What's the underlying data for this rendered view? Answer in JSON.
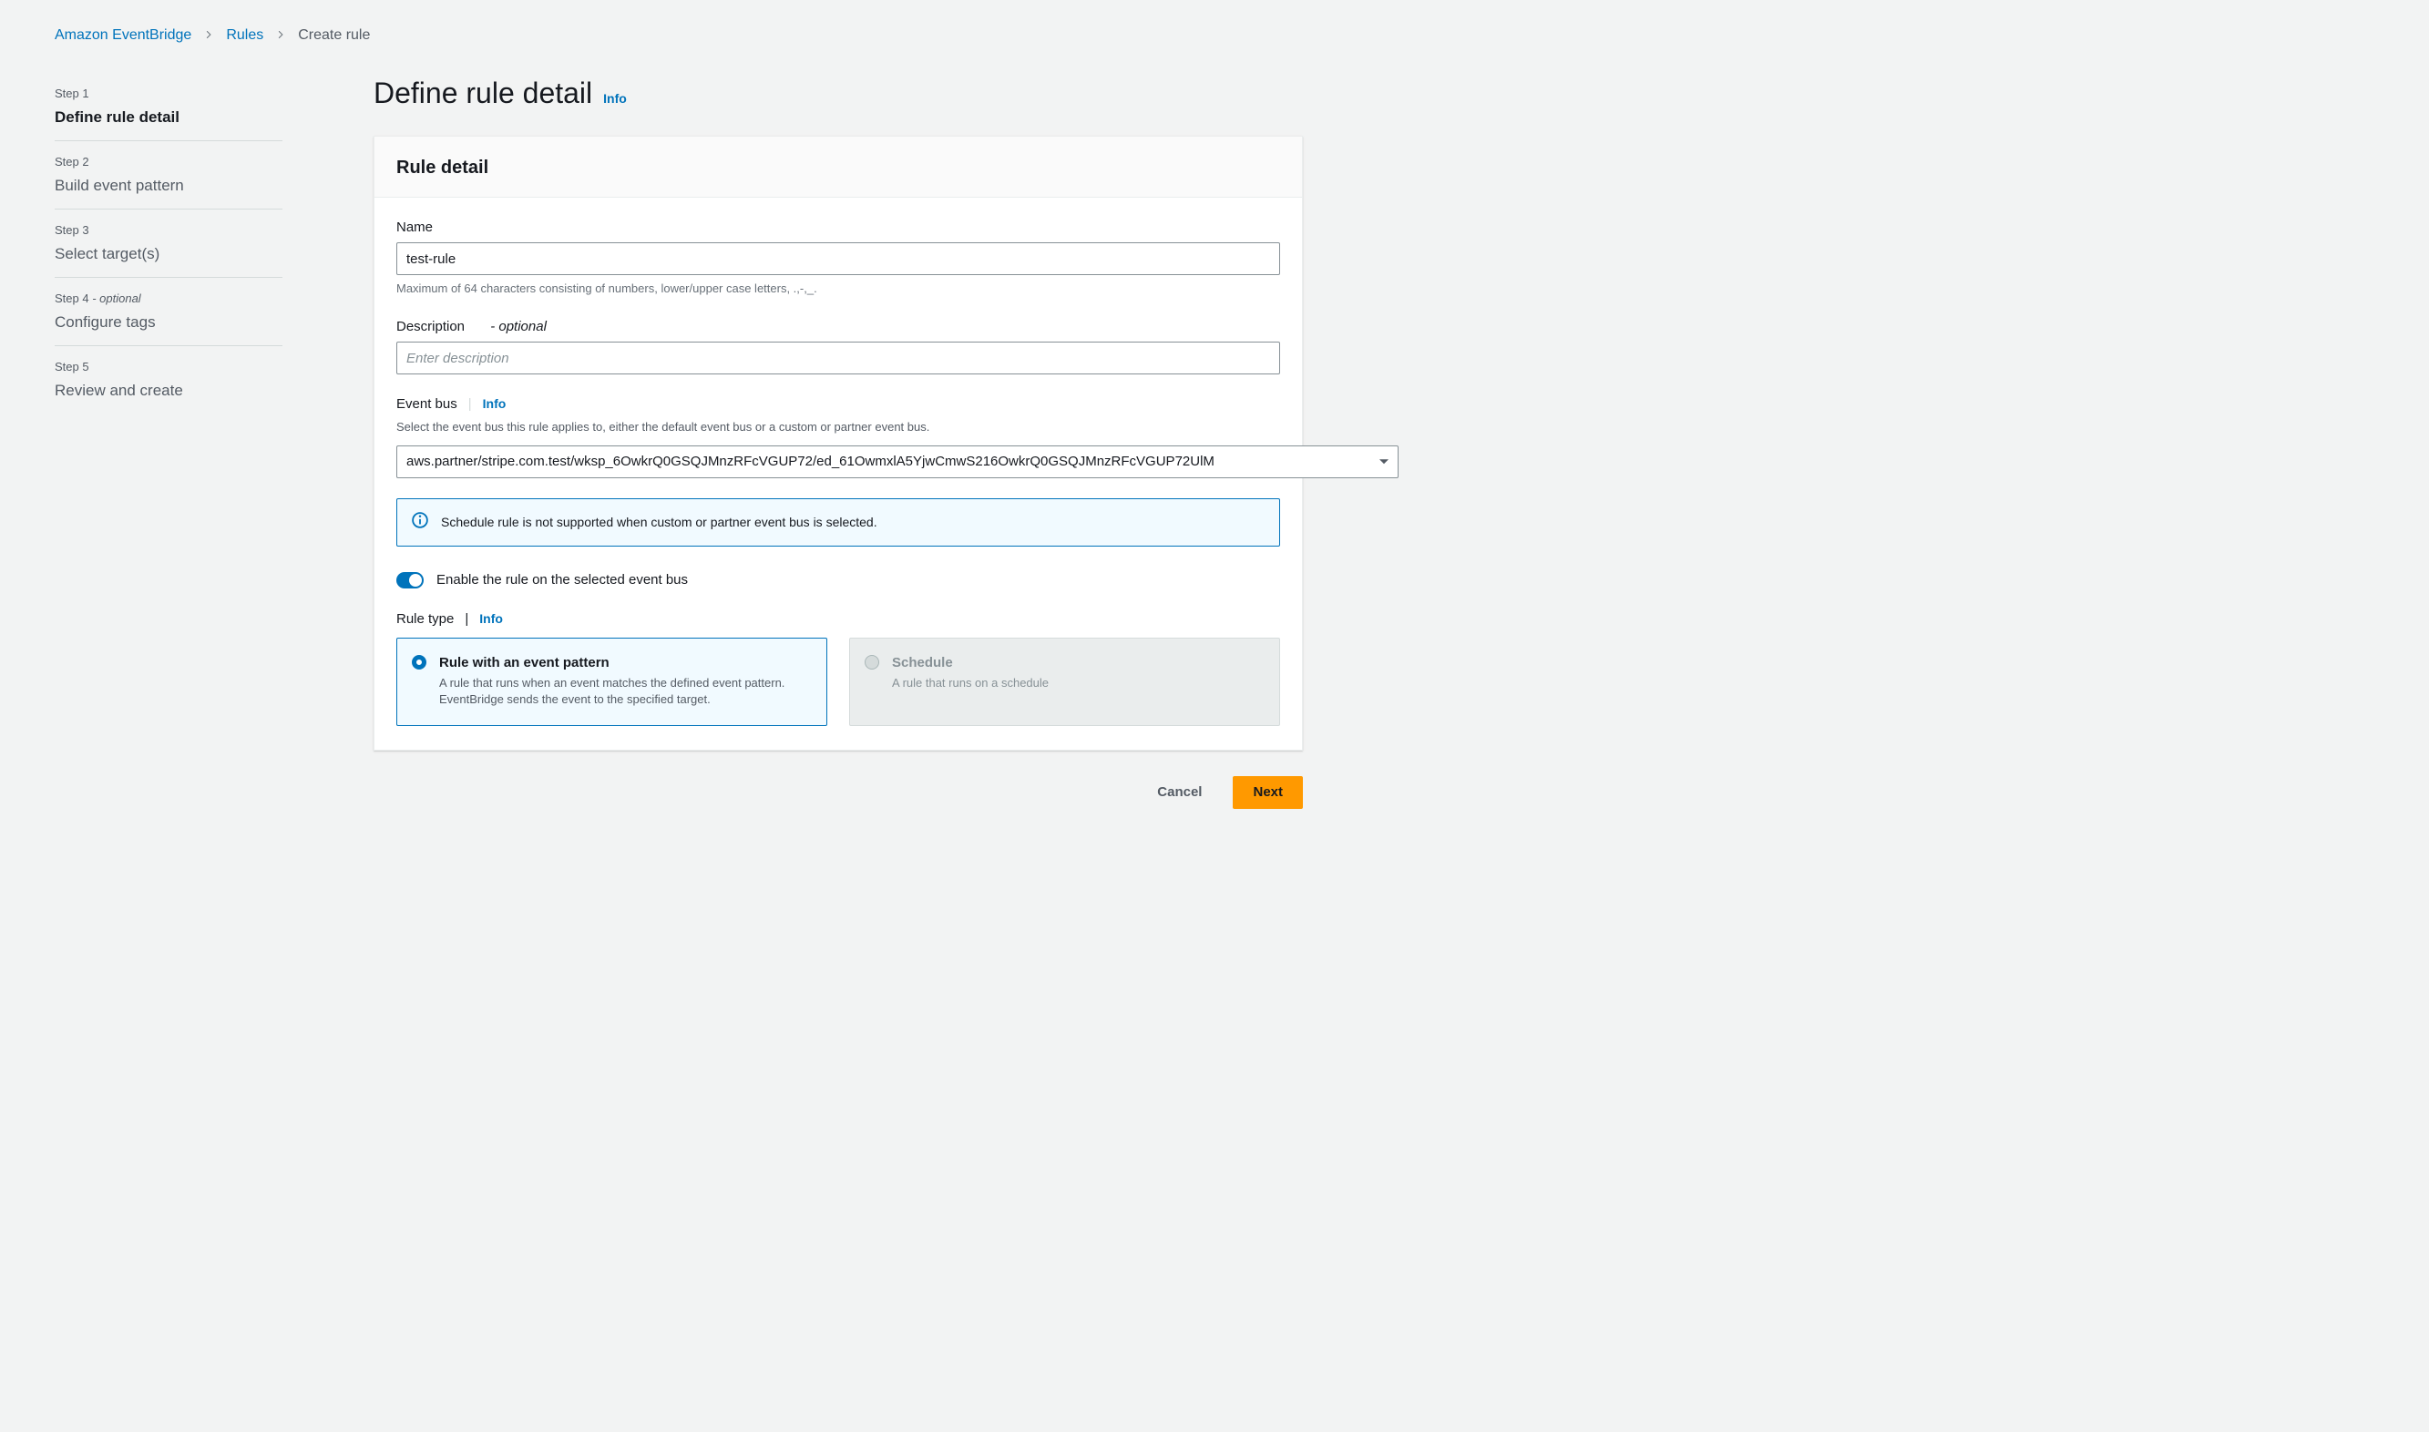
{
  "breadcrumb": {
    "service": "Amazon EventBridge",
    "section": "Rules",
    "current": "Create rule"
  },
  "steps": [
    {
      "num": "Step 1",
      "title": "Define rule detail",
      "optional": false,
      "active": true
    },
    {
      "num": "Step 2",
      "title": "Build event pattern",
      "optional": false,
      "active": false
    },
    {
      "num": "Step 3",
      "title": "Select target(s)",
      "optional": false,
      "active": false
    },
    {
      "num": "Step 4",
      "title": "Configure tags",
      "optional": true,
      "active": false
    },
    {
      "num": "Step 5",
      "title": "Review and create",
      "optional": false,
      "active": false
    }
  ],
  "page": {
    "title": "Define rule detail",
    "info": "Info"
  },
  "panel": {
    "header": "Rule detail",
    "name": {
      "label": "Name",
      "value": "test-rule",
      "help": "Maximum of 64 characters consisting of numbers, lower/upper case letters, .,-,_."
    },
    "description": {
      "label": "Description",
      "optional_suffix": "- optional",
      "placeholder": "Enter description",
      "value": ""
    },
    "event_bus": {
      "label": "Event bus",
      "info": "Info",
      "desc": "Select the event bus this rule applies to, either the default event bus or a custom or partner event bus.",
      "value": "aws.partner/stripe.com.test/wksp_6OwkrQ0GSQJMnzRFcVGUP72/ed_61OwmxlA5YjwCmwS216OwkrQ0GSQJMnzRFcVGUP72UlM"
    },
    "alert": "Schedule rule is not supported when custom or partner event bus is selected.",
    "enable_toggle": {
      "label": "Enable the rule on the selected event bus",
      "on": true
    },
    "rule_type": {
      "label": "Rule type",
      "info": "Info",
      "options": [
        {
          "title": "Rule with an event pattern",
          "desc": "A rule that runs when an event matches the defined event pattern. EventBridge sends the event to the specified target.",
          "selected": true,
          "disabled": false
        },
        {
          "title": "Schedule",
          "desc": "A rule that runs on a schedule",
          "selected": false,
          "disabled": true
        }
      ]
    }
  },
  "footer": {
    "cancel": "Cancel",
    "next": "Next"
  }
}
